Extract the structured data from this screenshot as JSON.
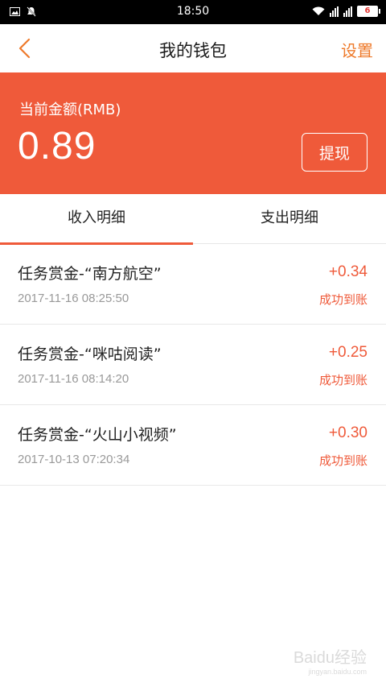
{
  "status_bar": {
    "time": "18:50",
    "battery": "6"
  },
  "nav": {
    "title": "我的钱包",
    "settings_label": "设置"
  },
  "balance": {
    "label": "当前金额(RMB)",
    "amount": "0.89",
    "withdraw_label": "提现"
  },
  "tabs": [
    {
      "label": "收入明细",
      "active": true
    },
    {
      "label": "支出明细",
      "active": false
    }
  ],
  "transactions": [
    {
      "name": "任务赏金-“南方航空”",
      "time": "2017-11-16 08:25:50",
      "amount": "+0.34",
      "status": "成功到账"
    },
    {
      "name": "任务赏金-“咪咕阅读”",
      "time": "2017-11-16 08:14:20",
      "amount": "+0.25",
      "status": "成功到账"
    },
    {
      "name": "任务赏金-“火山小视频”",
      "time": "2017-10-13 07:20:34",
      "amount": "+0.30",
      "status": "成功到账"
    }
  ],
  "watermark": {
    "text": "Baidu经验",
    "sub": "jingyan.baidu.com"
  },
  "colors": {
    "accent": "#ef5a3a",
    "nav_accent": "#ee7a2b"
  }
}
